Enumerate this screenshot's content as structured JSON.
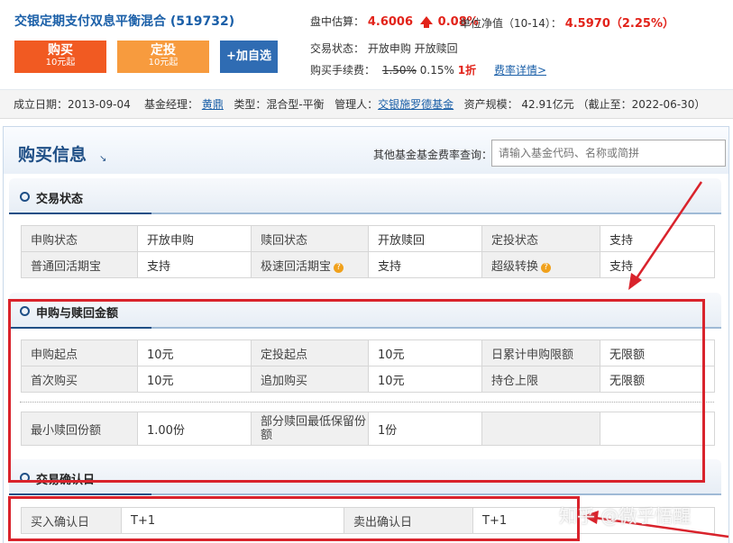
{
  "header": {
    "fund_title": "交银定期支付双息平衡混合 (519732)",
    "buy_button": {
      "label": "购买",
      "sub": "10元起"
    },
    "plan_button": {
      "label": "定投",
      "sub": "10元起"
    },
    "fav_button": "+加自选",
    "est_label": "盘中估算：",
    "est_value": "4.6006",
    "est_change": "0.08%",
    "nav_label": "单位净值（10-14）：",
    "nav_value": "4.5970（2.25%）",
    "trade_status": "交易状态：  开放申购    开放赎回",
    "fee_label": "购买手续费：",
    "fee_old": "1.50%",
    "fee_new": "0.15%",
    "fee_discount": "1折",
    "fee_link": "费率详情>"
  },
  "info_bar": {
    "est_date": "成立日期：2013-09-04",
    "manager_label": "基金经理：",
    "manager": "黄鼎",
    "type": "类型：混合型-平衡",
    "admin_label": "管理人：",
    "admin": "交银施罗德基金",
    "scale": "资产规模：  42.91亿元 （截止至：2022-06-30）"
  },
  "panel": {
    "title": "购买信息",
    "title_icon": "↘",
    "query_label": "其他基金基金费率查询：",
    "query_placeholder": "请输入基金代码、名称或简拼"
  },
  "sections": {
    "trade_status": {
      "title": "交易状态",
      "rows": [
        [
          "申购状态",
          "开放申购",
          "赎回状态",
          "开放赎回",
          "定投状态",
          "支持"
        ],
        [
          "普通回活期宝",
          "支持",
          "极速回活期宝",
          "支持",
          "超级转换",
          "支持"
        ]
      ]
    },
    "amounts": {
      "title": "申购与赎回金额",
      "rows": [
        [
          "申购起点",
          "10元",
          "定投起点",
          "10元",
          "日累计申购限额",
          "无限额"
        ],
        [
          "首次购买",
          "10元",
          "追加购买",
          "10元",
          "持仓上限",
          "无限额"
        ]
      ],
      "redeem_row": [
        "最小赎回份额",
        "1.00份",
        "部分赎回最低保留份额",
        "1份",
        "",
        ""
      ]
    },
    "confirm": {
      "title": "交易确认日",
      "row": [
        "买入确认日",
        "T+1",
        "卖出确认日",
        "T+1"
      ]
    }
  },
  "watermark": "知乎 @微乎悟醒",
  "colors": {
    "accent_red": "#e2231a",
    "brand_blue": "#1f4f86",
    "buy_orange": "#f15a22",
    "plan_orange": "#f79b3e",
    "annotation_red": "#d9232c"
  }
}
